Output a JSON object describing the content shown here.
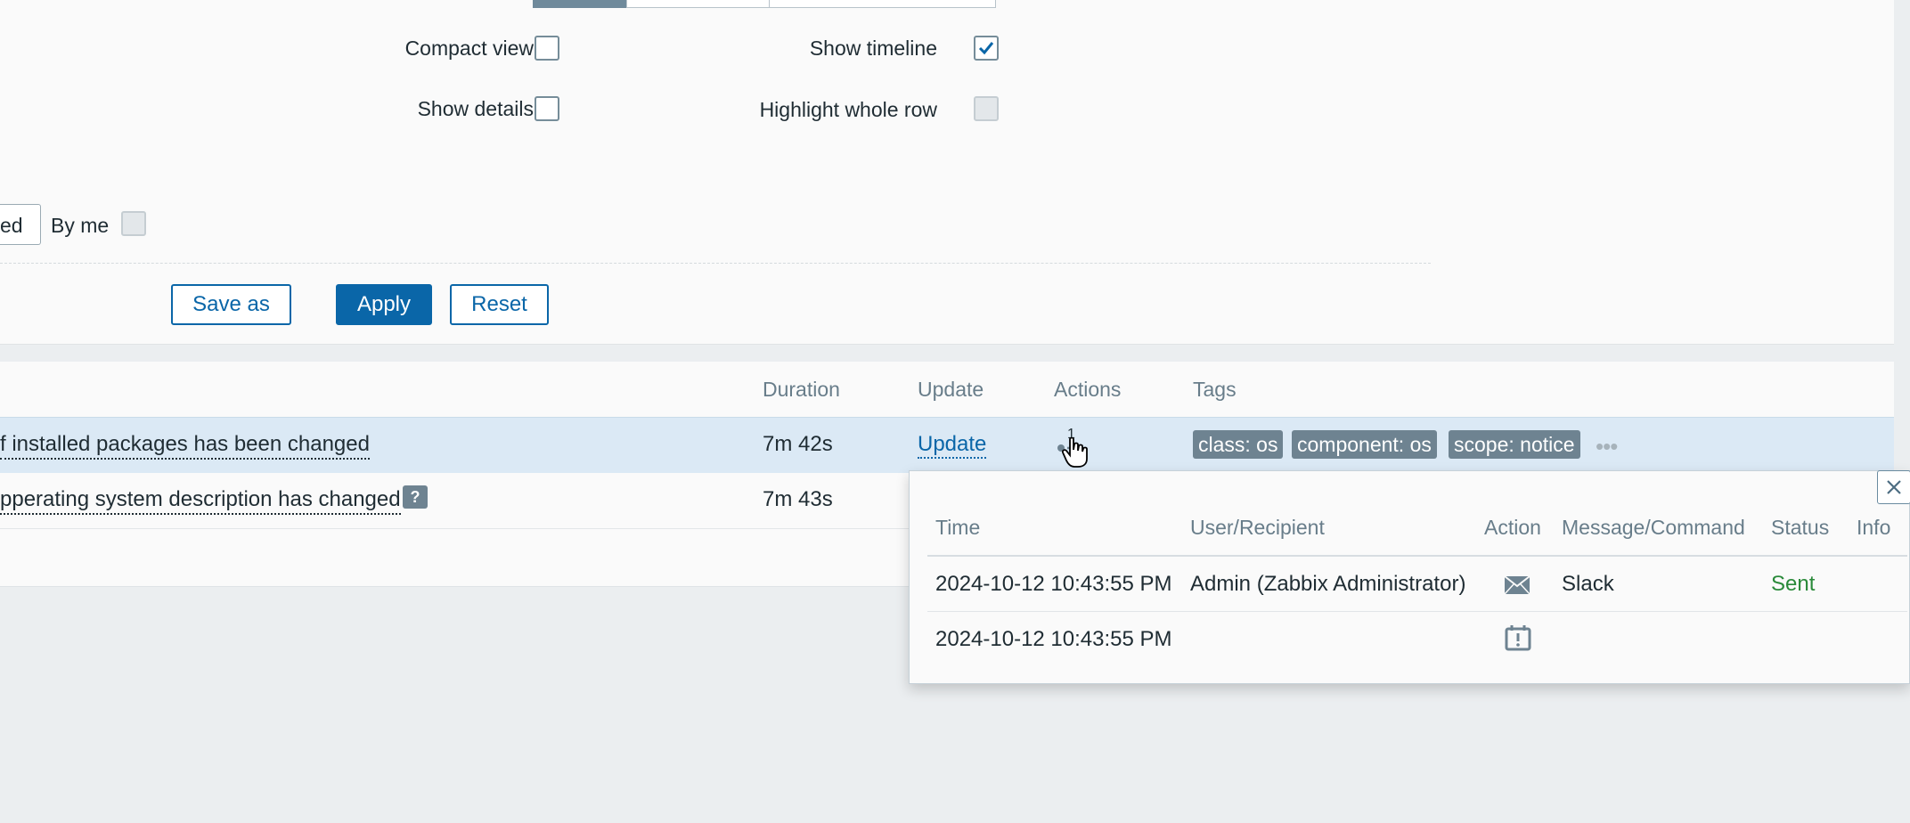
{
  "filter": {
    "compact_view_label": "Compact view",
    "show_details_label": "Show details",
    "show_timeline_label": "Show timeline",
    "highlight_row_label": "Highlight whole row",
    "select_value": "ed",
    "by_me_label": "By me",
    "save_as_label": "Save as",
    "apply_label": "Apply",
    "reset_label": "Reset",
    "compact_view_checked": false,
    "show_details_checked": false,
    "show_timeline_checked": true,
    "highlight_row_checked": false,
    "by_me_checked": false
  },
  "table": {
    "headers": {
      "duration": "Duration",
      "update": "Update",
      "actions": "Actions",
      "tags": "Tags"
    },
    "rows": [
      {
        "problem": "f installed packages has been changed",
        "duration": "7m 42s",
        "update": "Update",
        "actions_count": "1",
        "tags": [
          "class: os",
          "component: os",
          "scope: notice"
        ]
      },
      {
        "problem": "pperating system description has changed",
        "duration": "7m 43s",
        "help_icon": "?"
      }
    ]
  },
  "popup": {
    "headers": {
      "time": "Time",
      "user": "User/Recipient",
      "action": "Action",
      "message": "Message/Command",
      "status": "Status",
      "info": "Info"
    },
    "rows": [
      {
        "time": "2024-10-12 10:43:55 PM",
        "user": "Admin (Zabbix Administrator)",
        "action_icon": "envelope-icon",
        "message": "Slack",
        "status": "Sent"
      },
      {
        "time": "2024-10-12 10:43:55 PM",
        "user": "",
        "action_icon": "calendar-alert-icon",
        "message": "",
        "status": ""
      }
    ]
  },
  "colors": {
    "accent": "#0a66a8",
    "status_sent": "#2a8a3a",
    "tag_bg": "#6e8391",
    "selected_row": "#dbe9f5"
  }
}
